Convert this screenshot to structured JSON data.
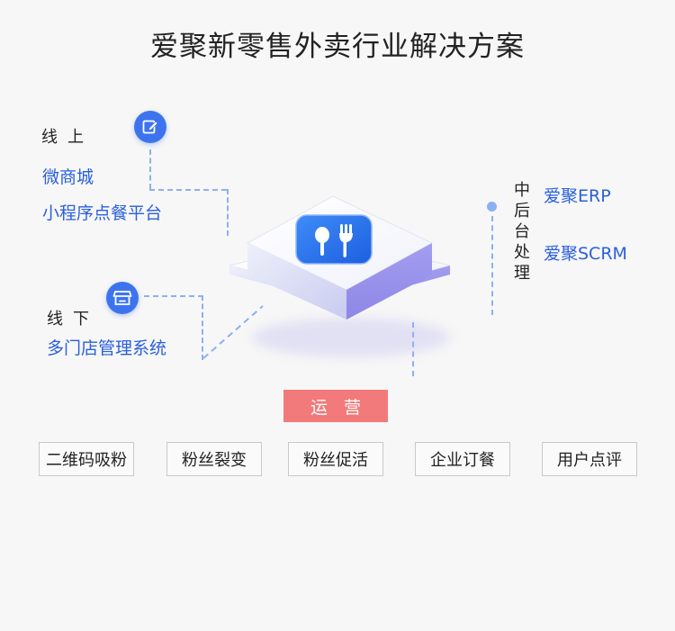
{
  "title": "爱聚新零售外卖行业解决方案",
  "online": {
    "label": "线上",
    "items": [
      "微商城",
      "小程序点餐平台"
    ]
  },
  "offline": {
    "label": "线下",
    "items": [
      "多门店管理系统"
    ]
  },
  "middle_platform": {
    "label": [
      "中",
      "后",
      "台",
      "处",
      "理"
    ],
    "items": [
      "爱聚ERP",
      "爱聚SCRM"
    ]
  },
  "operations": {
    "label": "运营",
    "tags": [
      "二维码吸粉",
      "粉丝裂变",
      "粉丝促活",
      "企业订餐",
      "用户点评"
    ]
  },
  "colors": {
    "accent_blue": "#3d74ee",
    "link_blue": "#2a5fdc",
    "dash_blue": "#8cb0f2",
    "operations_red": "#f37a7a"
  },
  "icons": {
    "online": "edit-icon",
    "offline": "store-icon",
    "center": "restaurant-icon"
  }
}
